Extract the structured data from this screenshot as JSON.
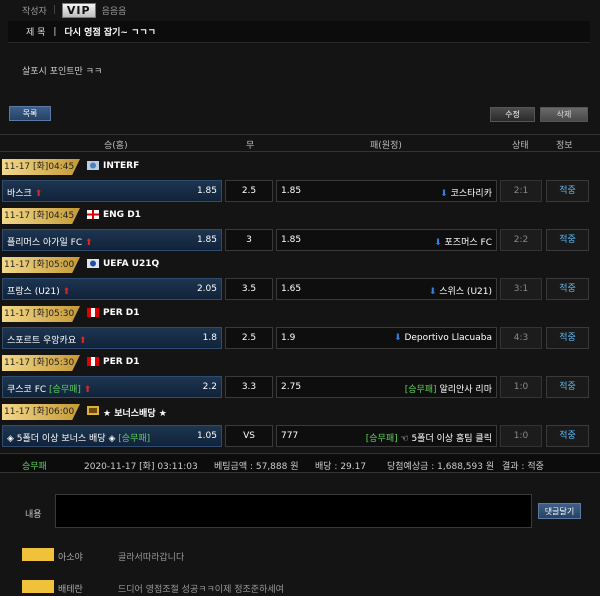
{
  "header": {
    "author_label": "작성자",
    "vip": "VIP",
    "author": "음음음"
  },
  "title": {
    "label": "제 목",
    "value": "다시 영점 잡기~ ㄱㄱㄱ"
  },
  "content": "살포시 포인트만 ㅋㅋ",
  "buttons": {
    "list": "목록",
    "edit": "수정",
    "delete": "삭제",
    "comment_submit": "댓글달기"
  },
  "table_headers": {
    "home": "승(홈)",
    "draw": "무",
    "away": "패(원정)",
    "status": "상태",
    "info": "정보"
  },
  "rows": [
    {
      "date": "11-17 [화]04:45",
      "league": "INTERF",
      "flag": "world",
      "home": "바스크",
      "home_odds": "1.85",
      "draw": "2.5",
      "away_odds": "1.85",
      "away": "코스타리카",
      "score": "2:1",
      "result": "적중"
    },
    {
      "date": "11-17 [화]04:45",
      "league": "ENG D1",
      "flag": "eng",
      "home": "플리머스 아가일 FC",
      "home_odds": "1.85",
      "draw": "3",
      "away_odds": "1.85",
      "away": "포즈머스 FC",
      "score": "2:2",
      "result": "적중"
    },
    {
      "date": "11-17 [화]05:00",
      "league": "UEFA U21Q",
      "flag": "uefa",
      "home": "프랑스 (U21)",
      "home_odds": "2.05",
      "draw": "3.5",
      "away_odds": "1.65",
      "away": "스위스 (U21)",
      "score": "3:1",
      "result": "적중"
    },
    {
      "date": "11-17 [화]05:30",
      "league": "PER D1",
      "flag": "per",
      "home": "스포르트 우앙카요",
      "home_odds": "1.8",
      "draw": "2.5",
      "away_odds": "1.9",
      "away": "Deportivo Llacuaba",
      "score": "4:3",
      "result": "적중"
    },
    {
      "date": "11-17 [화]05:30",
      "league": "PER D1",
      "flag": "per",
      "home": "쿠스코 FC",
      "home_tag": "[승무패]",
      "home_odds": "2.2",
      "draw": "3.3",
      "away_odds": "2.75",
      "away_tag": "[승무패]",
      "away": "알리안사 리마",
      "score": "1:0",
      "result": "적중"
    },
    {
      "date": "11-17 [화]06:00",
      "league": "★ 보너스배당 ★",
      "flag": "bonus",
      "home": "◈ 5폴더 이상 보너스 배당 ◈",
      "home_tag": "[승무패]",
      "home_odds": "1.05",
      "draw": "VS",
      "away_odds": "777",
      "away_tag": "[승무패]",
      "away": "☜ 5폴더 이상 홈팀 클릭",
      "score": "1:0",
      "result": "적중"
    }
  ],
  "summary": {
    "type": "승무패",
    "datetime": "2020-11-17 [화] 03:11:03",
    "bet_amount": "베팅금액 : 57,888 원",
    "odds": "배당 : 29.17",
    "expected": "당첨예상금 : 1,688,593 원",
    "result": "결과 : 적중"
  },
  "comment_form": {
    "label": "내용"
  },
  "comments": [
    {
      "user": "아소야",
      "text": "골라서따라갑니다"
    },
    {
      "user": "배테란",
      "text": "드디어 영점조절 성공ㅋㅋ이제 정조준하세여"
    }
  ]
}
